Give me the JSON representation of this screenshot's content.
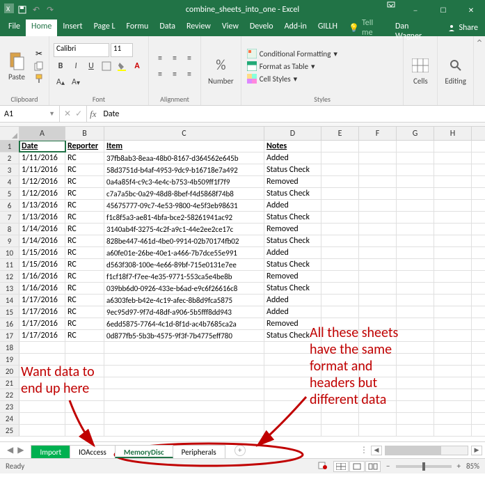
{
  "title": "combine_sheets_into_one - Excel",
  "user_name": "Dan Wagner",
  "share_label": "Share",
  "tell_me_label": "Tell me",
  "ribbon_tabs": {
    "file": "File",
    "home": "Home",
    "insert": "Insert",
    "page": "Page L",
    "formulas": "Formu",
    "data": "Data",
    "review": "Review",
    "view": "View",
    "developer": "Develo",
    "addins": "Add-in",
    "gill": "GILLH"
  },
  "ribbon": {
    "paste": "Paste",
    "number": "Number",
    "cells": "Cells",
    "editing": "Editing",
    "clipboard_label": "Clipboard",
    "font_label": "Font",
    "alignment_label": "Alignment",
    "styles_label": "Styles",
    "font_name": "Calibri",
    "font_size": "11",
    "cond_fmt": "Conditional Formatting",
    "fmt_table": "Format as Table",
    "cell_styles": "Cell Styles"
  },
  "name_box": "A1",
  "formula": "Date",
  "columns": [
    "A",
    "B",
    "C",
    "D",
    "E",
    "F",
    "G",
    "H"
  ],
  "headers": {
    "A": "Date",
    "B": "Reporter",
    "C": "Item",
    "D": "Notes"
  },
  "data_rows": [
    {
      "A": "1/11/2016",
      "B": "RC",
      "C": "37fb8ab3-8eaa-48b0-8167-d364562e645b",
      "D": "Added"
    },
    {
      "A": "1/11/2016",
      "B": "RC",
      "C": "58d3751d-b4af-4953-9dc9-b16718e7a492",
      "D": "Status Check"
    },
    {
      "A": "1/12/2016",
      "B": "RC",
      "C": "0a4a85f4-c9c3-4e4c-b753-4b509ff1f7f9",
      "D": "Removed"
    },
    {
      "A": "1/12/2016",
      "B": "RC",
      "C": "c7a7a5bc-0a29-48d8-8bef-f4d5868f74b8",
      "D": "Status Check"
    },
    {
      "A": "1/13/2016",
      "B": "RC",
      "C": "45675777-09c7-4e53-9800-4e5f3eb98631",
      "D": "Added"
    },
    {
      "A": "1/13/2016",
      "B": "RC",
      "C": "f1c8f5a3-ae81-4bfa-bce2-58261941ac92",
      "D": "Status Check"
    },
    {
      "A": "1/14/2016",
      "B": "RC",
      "C": "3140ab4f-3275-4c2f-a9c1-44e2ee2ce17c",
      "D": "Removed"
    },
    {
      "A": "1/14/2016",
      "B": "RC",
      "C": "828be447-461d-4be0-9914-02b70174fb02",
      "D": "Status Check"
    },
    {
      "A": "1/15/2016",
      "B": "RC",
      "C": "a60fe01e-26be-40e1-a466-7b7dce55e991",
      "D": "Added"
    },
    {
      "A": "1/15/2016",
      "B": "RC",
      "C": "d563f308-100e-4e66-89bf-715e0131e7ee",
      "D": "Status Check"
    },
    {
      "A": "1/16/2016",
      "B": "RC",
      "C": "f1cf18f7-f7ee-4e35-9771-553ca5e4be8b",
      "D": "Removed"
    },
    {
      "A": "1/16/2016",
      "B": "RC",
      "C": "039bb6d0-0926-433e-b6ad-e9c6f26616c8",
      "D": "Status Check"
    },
    {
      "A": "1/17/2016",
      "B": "RC",
      "C": "a6303feb-b42e-4c19-afec-8b8d9fca5875",
      "D": "Added"
    },
    {
      "A": "1/17/2016",
      "B": "RC",
      "C": "9ec95d97-9f7d-48df-a906-5b5fff8dd943",
      "D": "Added"
    },
    {
      "A": "1/17/2016",
      "B": "RC",
      "C": "6edd5875-7764-4c1d-8f1d-ac4b7685ca2a",
      "D": "Removed"
    },
    {
      "A": "1/17/2016",
      "B": "RC",
      "C": "0d877fb5-5b3b-4575-9f3f-7b4775eff780",
      "D": "Status Check"
    }
  ],
  "empty_rows": 8,
  "sheet_tabs": [
    "Import",
    "IOAccess",
    "MemoryDisc",
    "Peripherals"
  ],
  "active_sheet": "MemoryDisc",
  "green_sheet": "Import",
  "status_ready": "Ready",
  "zoom": "85%",
  "annotations": {
    "left": "Want data to\nend up here",
    "right": "All these sheets\nhave the same\nformat and\nheaders but\ndifferent data"
  }
}
